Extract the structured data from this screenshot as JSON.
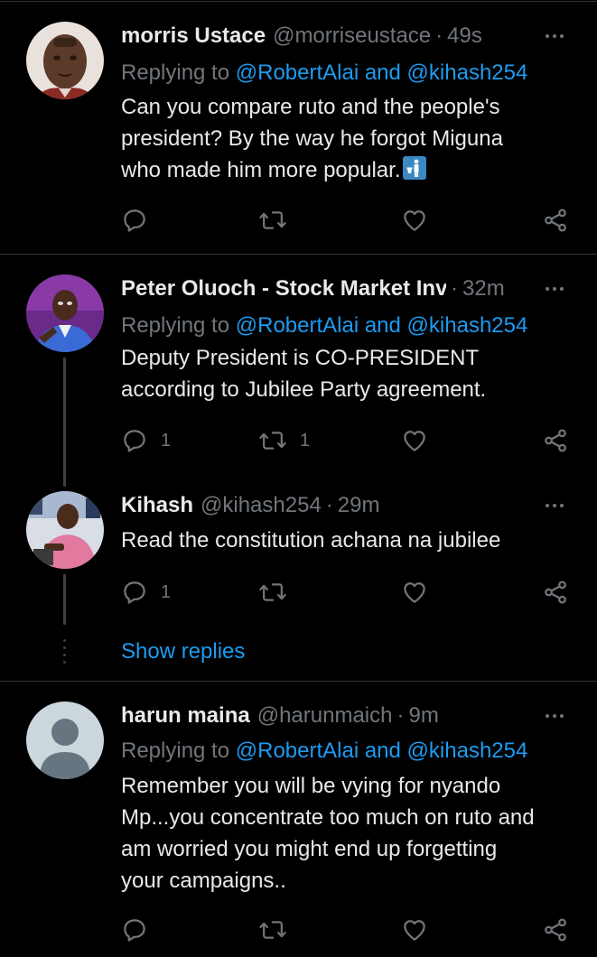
{
  "tweets": [
    {
      "name": "morris Ustace",
      "handle": "@morriseustace",
      "time": "49s",
      "replying_prefix": "Replying to ",
      "replying_mentions": "@RobertAlai and @kihash254",
      "text_lines": [
        "Can you compare ruto and the people's",
        "president? By the way he forgot Miguna",
        "who made him more popular."
      ],
      "emoji": "toilet-sign",
      "reply_count": "",
      "retweet_count": "",
      "like_count": ""
    },
    {
      "name": "Peter Oluoch - Stock Market Inᴠ",
      "handle": "",
      "time": "32m",
      "replying_prefix": "Replying to ",
      "replying_mentions": "@RobertAlai and @kihash254",
      "text_lines": [
        "Deputy President is CO-PRESIDENT",
        "according to Jubilee Party agreement."
      ],
      "reply_count": "1",
      "retweet_count": "1",
      "like_count": ""
    },
    {
      "name": "Kihash",
      "handle": "@kihash254",
      "time": "29m",
      "text_lines": [
        "Read the constitution achana na jubilee"
      ],
      "reply_count": "1",
      "retweet_count": "",
      "like_count": ""
    },
    {
      "name": "harun maina",
      "handle": "@harunmaich",
      "time": "9m",
      "replying_prefix": "Replying to ",
      "replying_mentions": "@RobertAlai and @kihash254",
      "text_lines": [
        "Remember you will be vying for nyando",
        "Mp...you concentrate too much on ruto and",
        "am worried you might end up forgetting",
        "your campaigns.."
      ],
      "reply_count": "",
      "retweet_count": "",
      "like_count": ""
    }
  ],
  "show_replies_label": "Show replies",
  "colors": {
    "background": "#000000",
    "text": "#e7e9ea",
    "muted": "#71767b",
    "link": "#1d9bf0",
    "divider": "#2f3336"
  },
  "icons": [
    "reply-icon",
    "retweet-icon",
    "like-icon",
    "share-icon",
    "more-icon"
  ]
}
